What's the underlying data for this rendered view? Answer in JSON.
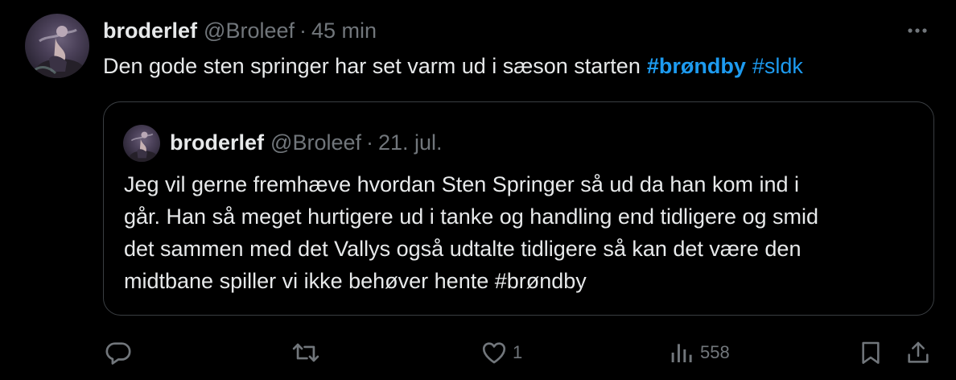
{
  "tweet": {
    "author": {
      "display_name": "broderlef",
      "handle": "@Broleef"
    },
    "separator": "·",
    "time": "45 min",
    "text_prefix": "Den gode sten springer har set varm ud i sæson starten",
    "hashtags": [
      "#brøndby",
      "#sldk"
    ],
    "more_icon": "more-horizontal-icon"
  },
  "quoted_tweet": {
    "author": {
      "display_name": "broderlef",
      "handle": "@Broleef"
    },
    "separator": "·",
    "date": "21. jul.",
    "lines": [
      "Jeg vil gerne fremhæve hvordan Sten Springer så ud da han kom ind i",
      "går. Han så meget hurtigere ud i tanke og handling end tidligere og smid",
      "det sammen med det Vallys også udtalte tidligere så kan det være den",
      "midtbane spiller vi ikke behøver hente #brøndby"
    ]
  },
  "actions": {
    "reply": {
      "icon": "reply-icon",
      "count": ""
    },
    "retweet": {
      "icon": "retweet-icon",
      "count": ""
    },
    "like": {
      "icon": "heart-icon",
      "count": "1"
    },
    "views": {
      "icon": "views-icon",
      "count": "558"
    },
    "bookmark": {
      "icon": "bookmark-icon"
    },
    "share": {
      "icon": "share-icon"
    }
  },
  "colors": {
    "background": "#000000",
    "text": "#e7e9ea",
    "secondary": "#71767b",
    "accent": "#1d9bf0",
    "border": "#3a3e42"
  }
}
